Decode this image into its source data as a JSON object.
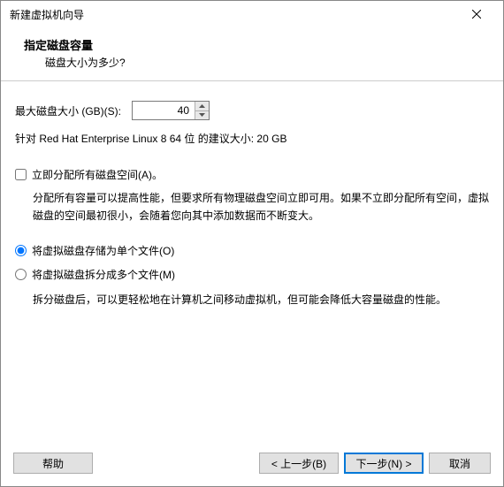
{
  "titlebar": {
    "title": "新建虚拟机向导"
  },
  "header": {
    "title": "指定磁盘容量",
    "subtitle": "磁盘大小为多少?"
  },
  "form": {
    "size_label": "最大磁盘大小 (GB)(S):",
    "size_value": "40",
    "recommend": "针对 Red Hat Enterprise Linux 8 64 位 的建议大小: 20 GB",
    "allocate_now_label": "立即分配所有磁盘空间(A)。",
    "allocate_now_explain": "分配所有容量可以提高性能，但要求所有物理磁盘空间立即可用。如果不立即分配所有空间，虚拟磁盘的空间最初很小，会随着您向其中添加数据而不断变大。",
    "store_single_label": "将虚拟磁盘存储为单个文件(O)",
    "store_split_label": "将虚拟磁盘拆分成多个文件(M)",
    "split_explain": "拆分磁盘后，可以更轻松地在计算机之间移动虚拟机，但可能会降低大容量磁盘的性能。"
  },
  "buttons": {
    "help": "帮助",
    "back": "< 上一步(B)",
    "next": "下一步(N) >",
    "cancel": "取消"
  }
}
